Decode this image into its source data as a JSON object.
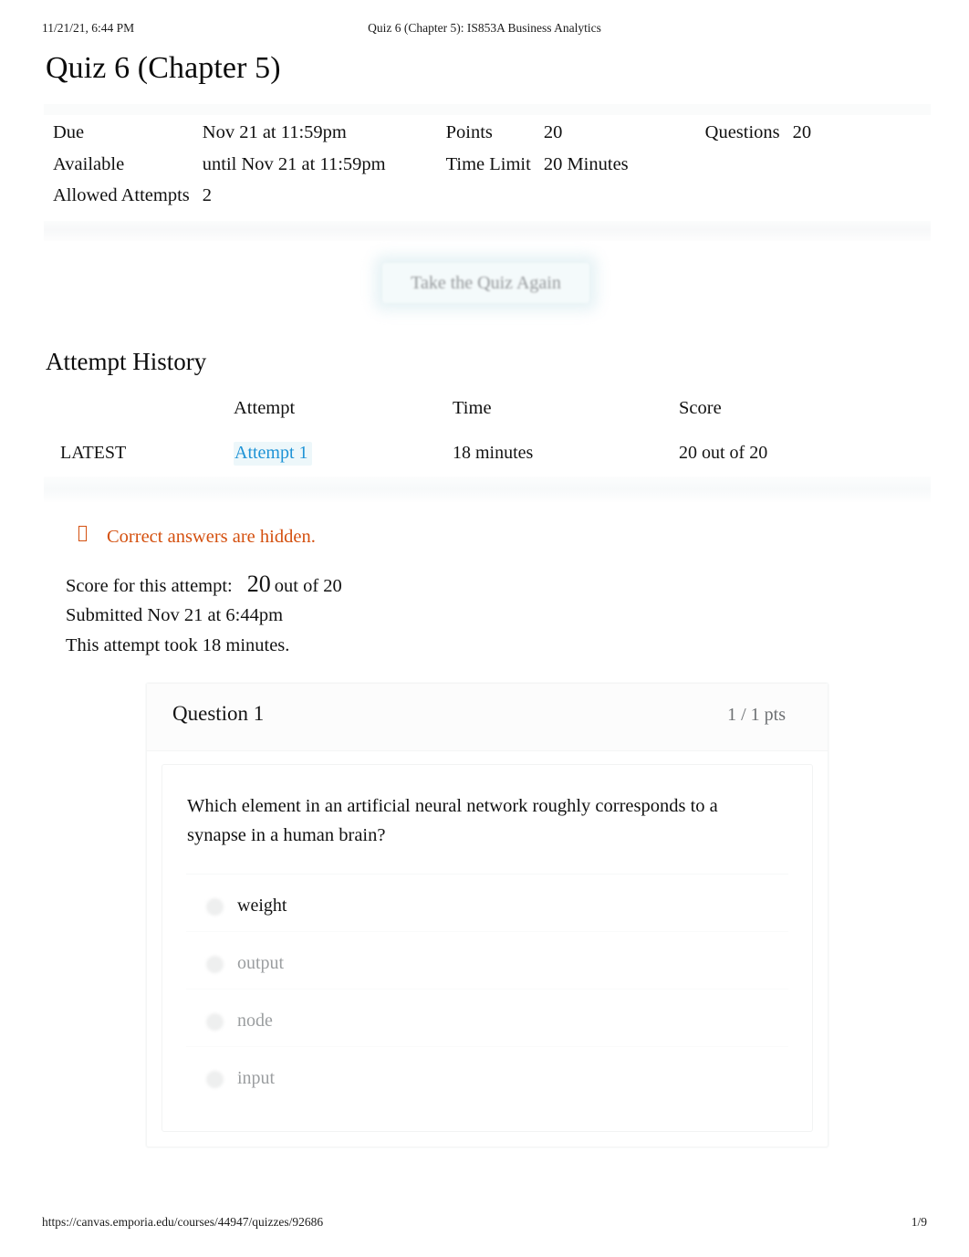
{
  "print_header": {
    "date": "11/21/21, 6:44 PM",
    "title": "Quiz 6 (Chapter 5): IS853A Business Analytics"
  },
  "print_footer": {
    "url": "https://canvas.emporia.edu/courses/44947/quizzes/92686",
    "page": "1/9"
  },
  "page_title": "Quiz 6 (Chapter 5)",
  "details": {
    "rows": [
      {
        "label1": "Due",
        "value1": "Nov 21 at 11:59pm",
        "label2": "Points",
        "value2": "20",
        "label3": "Questions",
        "value3": "20"
      },
      {
        "label1": "Available",
        "value1": "until Nov 21 at 11:59pm",
        "label2": "Time Limit",
        "value2": "20 Minutes",
        "label3": "",
        "value3": ""
      },
      {
        "label1": "Allowed Attempts",
        "value1": "2",
        "label2": "",
        "value2": "",
        "label3": "",
        "value3": ""
      }
    ]
  },
  "retake_button": {
    "label": "Take the Quiz Again"
  },
  "attempt_history": {
    "heading": "Attempt History",
    "columns": [
      "",
      "Attempt",
      "Time",
      "Score"
    ],
    "rows": [
      {
        "kept": "LATEST",
        "attempt": "Attempt 1",
        "time": "18 minutes",
        "score": "20 out of 20"
      }
    ]
  },
  "notice": {
    "icon": "warning-icon",
    "text": "Correct answers are hidden."
  },
  "summary": {
    "score_label": "Score for this attempt:",
    "score_value": "20",
    "score_of": "out of 20",
    "submitted": "Submitted Nov 21 at 6:44pm",
    "duration": "This attempt took 18 minutes."
  },
  "question": {
    "name": "Question 1",
    "points": "1 / 1 pts",
    "text": "Which element in an artificial neural network roughly corresponds to a synapse in a human brain?",
    "answers": [
      {
        "label": "weight",
        "selected": true
      },
      {
        "label": "output",
        "selected": false
      },
      {
        "label": "node",
        "selected": false
      },
      {
        "label": "input",
        "selected": false
      }
    ]
  },
  "colors": {
    "link": "#1e93d6",
    "notice": "#d4500f",
    "text": "#141414",
    "muted": "#9b9ea0",
    "button_bg": "#f4fafb"
  }
}
